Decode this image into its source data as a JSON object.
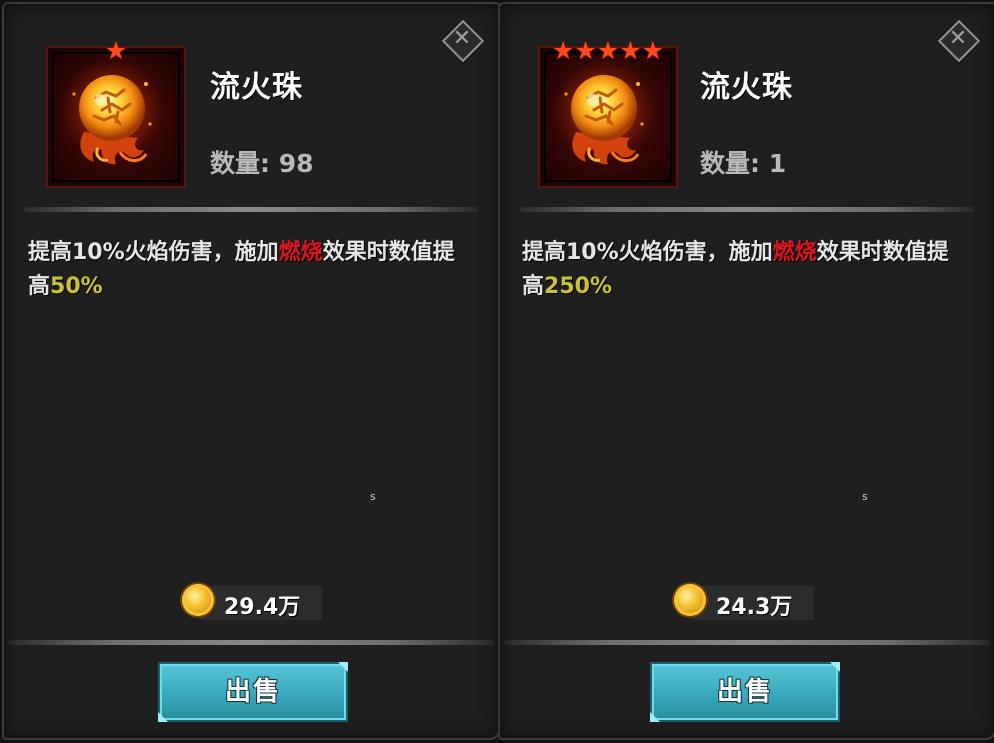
{
  "panels": [
    {
      "item_name": "流火珠",
      "stars": "★",
      "star_count": 1,
      "quantity_label": "数量: 98",
      "description": {
        "part1": "提高10%火焰伤害，施加",
        "burn": "燃烧",
        "part2": "效果时数值提高",
        "percent": "50%"
      },
      "small_text": "s",
      "price": "29.4万",
      "sell_label": "出售",
      "close_symbol": "✕",
      "icon": "fire-orb-icon",
      "coin_icon": "gold-coin-icon"
    },
    {
      "item_name": "流火珠",
      "stars": "★★★★★",
      "star_count": 5,
      "quantity_label": "数量: 1",
      "description": {
        "part1": "提高10%火焰伤害，施加",
        "burn": "燃烧",
        "part2": "效果时数值提高",
        "percent": "250%"
      },
      "small_text": "s",
      "price": "24.3万",
      "sell_label": "出售",
      "close_symbol": "✕",
      "icon": "fire-orb-icon",
      "coin_icon": "gold-coin-icon"
    }
  ],
  "colors": {
    "burn_text": "#d8161c",
    "percent_text": "#c8c238",
    "star": "#ff4b1a",
    "sell_button": "#38a8bc"
  }
}
